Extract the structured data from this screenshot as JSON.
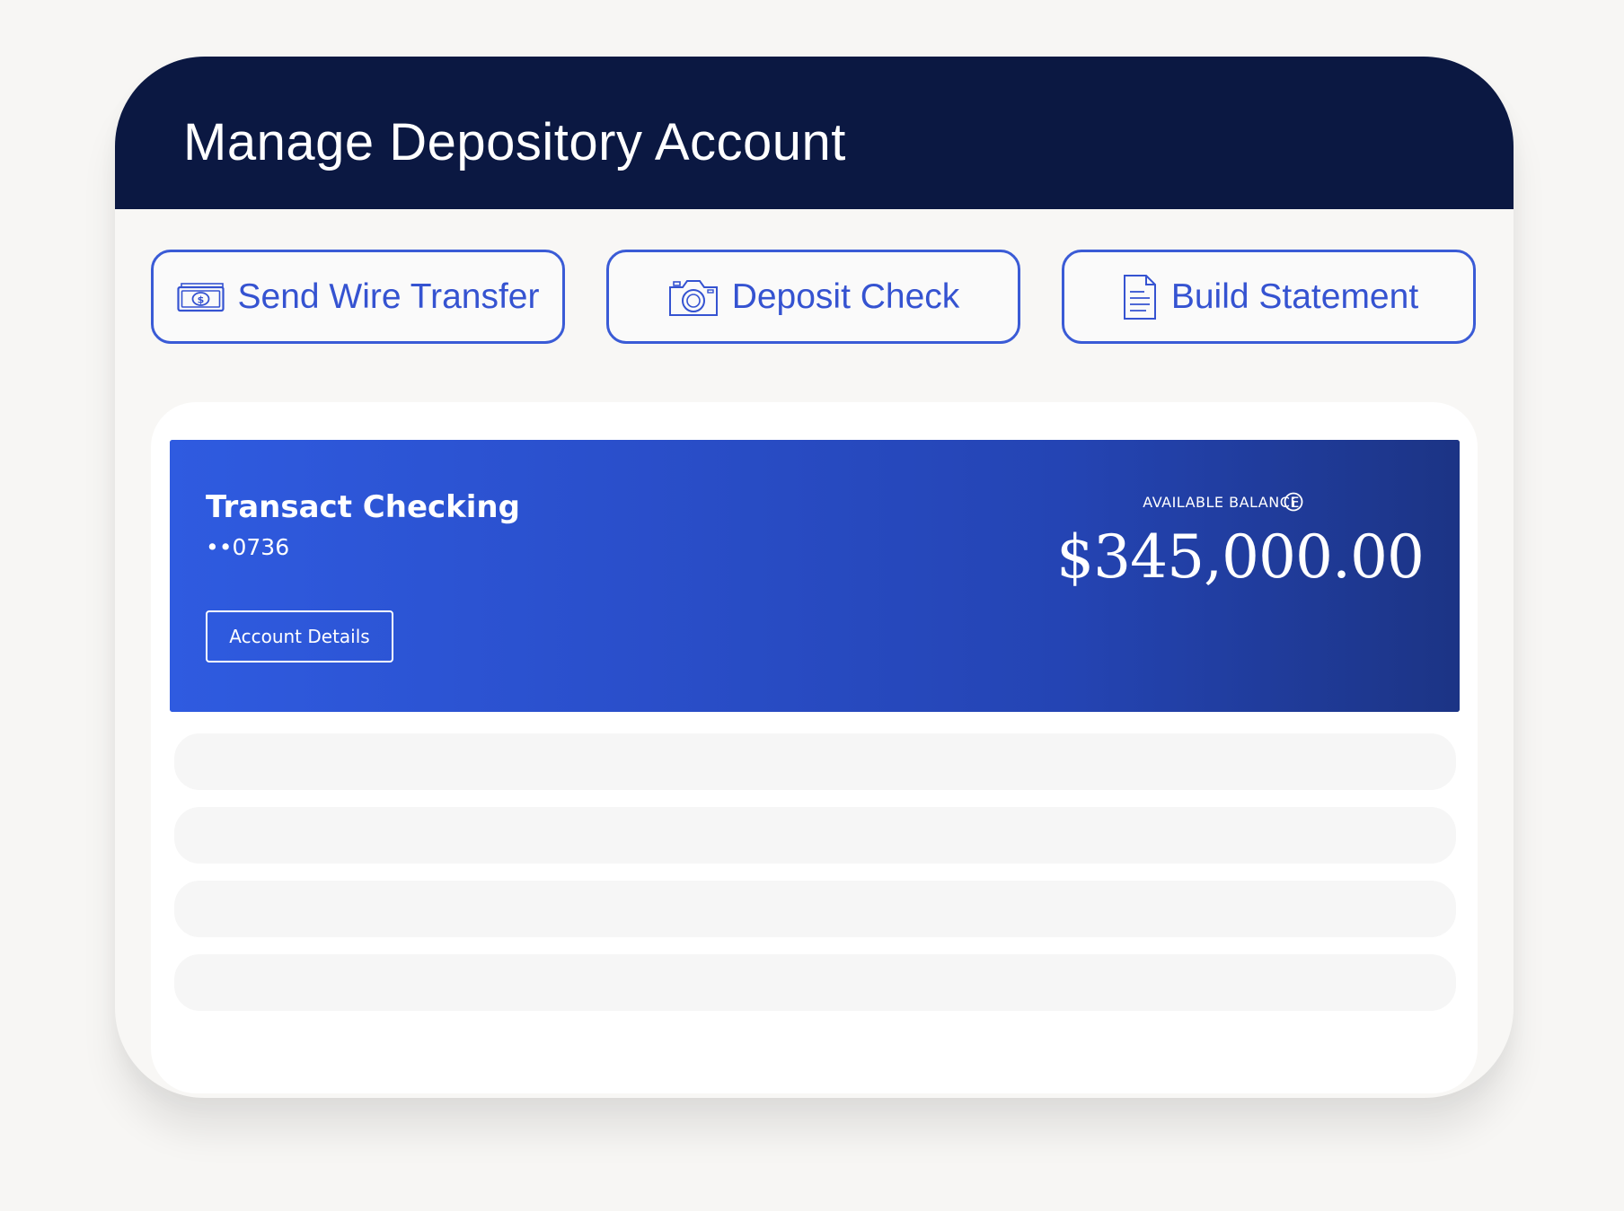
{
  "header": {
    "title": "Manage Depository Account"
  },
  "actions": [
    {
      "label": "Send Wire Transfer",
      "icon": "cash-icon"
    },
    {
      "label": "Deposit Check",
      "icon": "camera-icon"
    },
    {
      "label": "Build Statement",
      "icon": "document-icon"
    }
  ],
  "account": {
    "name": "Transact Checking",
    "number": "••0736",
    "details_button": "Account Details",
    "balance_label": "AVAILABLE BALANCE",
    "balance": "$345,000.00"
  },
  "colors": {
    "header_bg": "#0b1842",
    "accent": "#3553d1",
    "card_gradient_start": "#2f5be0",
    "card_gradient_end": "#1c3485"
  }
}
